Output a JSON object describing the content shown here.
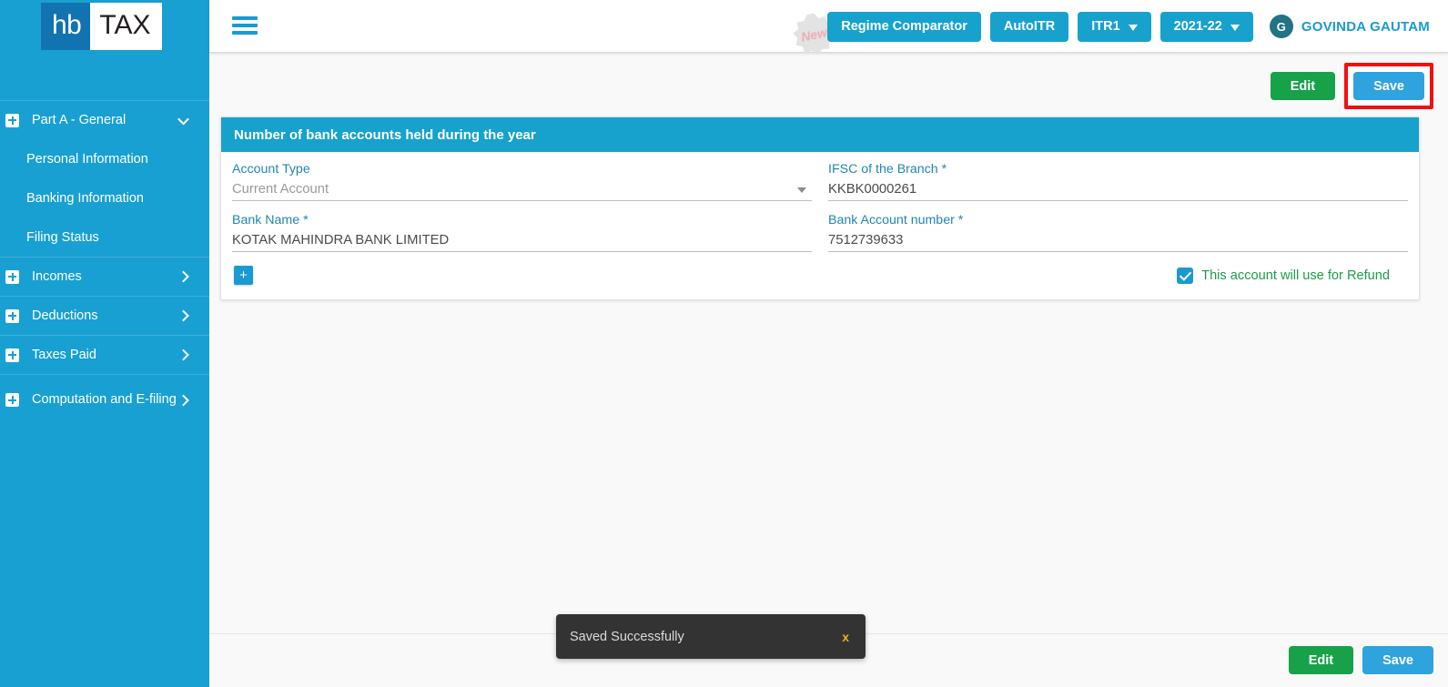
{
  "brand": {
    "logo_hb": "hb",
    "logo_tax": "TAX",
    "sidebar_color": "#18a0d2",
    "accent_blue": "#17a2cd",
    "green": "#17a24a"
  },
  "sidebar": {
    "groups": [
      {
        "label": "Part A - General",
        "icon": "plus-square-icon",
        "chevron": "chevron-down-icon",
        "expanded": true,
        "children": [
          {
            "label": "Personal Information"
          },
          {
            "label": "Banking Information"
          },
          {
            "label": "Filing Status"
          }
        ]
      },
      {
        "label": "Incomes",
        "icon": "plus-square-icon",
        "chevron": "chevron-right-icon",
        "expanded": false,
        "children": []
      },
      {
        "label": "Deductions",
        "icon": "plus-square-icon",
        "chevron": "chevron-right-icon",
        "expanded": false,
        "children": []
      },
      {
        "label": "Taxes Paid",
        "icon": "plus-square-icon",
        "chevron": "chevron-right-icon",
        "expanded": false,
        "children": []
      },
      {
        "label": "Computation and E-filing",
        "icon": "plus-square-icon",
        "chevron": "chevron-right-icon",
        "expanded": false,
        "children": []
      }
    ]
  },
  "header": {
    "menu_icon": "hamburger-icon",
    "new_badge": "New",
    "regime_comparator": "Regime Comparator",
    "auto_itr": "AutoITR",
    "itr_select": "ITR1",
    "year_select": "2021-22",
    "user": {
      "initial": "G",
      "name": "GOVINDA GAUTAM"
    }
  },
  "toolbar": {
    "edit_label": "Edit",
    "save_label": "Save",
    "save_highlight_color": "#f40f0f"
  },
  "card": {
    "title": "Number of bank accounts held during the year",
    "fields": [
      {
        "label": "Account Type",
        "required": false,
        "value": "Current Account",
        "type": "select",
        "muted": true
      },
      {
        "label": "IFSC of the Branch",
        "required": true,
        "value": "KKBK0000261",
        "type": "text",
        "muted": false
      },
      {
        "label": "Bank Name",
        "required": true,
        "value": "KOTAK MAHINDRA BANK LIMITED",
        "type": "text",
        "muted": false
      },
      {
        "label": "Bank Account number",
        "required": true,
        "value": "7512739633",
        "type": "text",
        "muted": false
      }
    ],
    "add_button": "+",
    "refund_checkbox": {
      "checked": true,
      "label": "This account will use for Refund"
    }
  },
  "toast": {
    "message": "Saved Successfully",
    "close_label": "x"
  },
  "footer": {
    "edit_label": "Edit",
    "save_label": "Save"
  }
}
